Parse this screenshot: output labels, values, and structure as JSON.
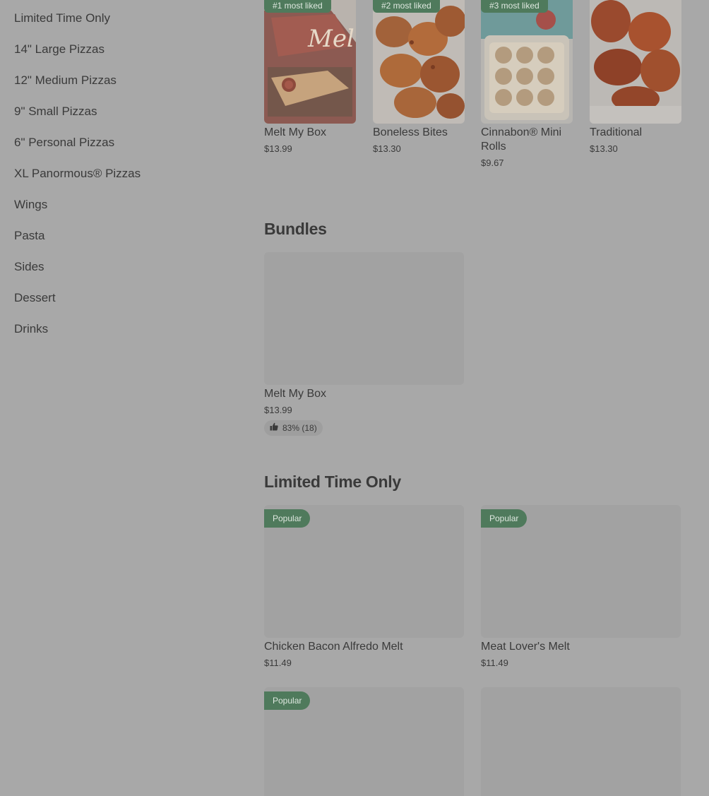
{
  "sidebar": {
    "items": [
      {
        "label": "Limited Time Only"
      },
      {
        "label": "14\" Large Pizzas"
      },
      {
        "label": "12\" Medium Pizzas"
      },
      {
        "label": "9\" Small Pizzas"
      },
      {
        "label": "6\" Personal Pizzas"
      },
      {
        "label": "XL Panormous® Pizzas"
      },
      {
        "label": "Wings"
      },
      {
        "label": "Pasta"
      },
      {
        "label": "Sides"
      },
      {
        "label": "Dessert"
      },
      {
        "label": "Drinks"
      }
    ]
  },
  "featured": {
    "items": [
      {
        "badge": "#1 most liked",
        "name": "Melt My Box",
        "price": "$13.99"
      },
      {
        "badge": "#2 most liked",
        "name": "Boneless Bites",
        "price": "$13.30"
      },
      {
        "badge": "#3 most liked",
        "name": "Cinnabon® Mini Rolls",
        "price": "$9.67"
      },
      {
        "name": "Traditional",
        "price": "$13.30"
      }
    ]
  },
  "bundles": {
    "title": "Bundles",
    "items": [
      {
        "name": "Melt My Box",
        "price": "$13.99",
        "rating": "83% (18)"
      }
    ]
  },
  "limited": {
    "title": "Limited Time Only",
    "items": [
      {
        "badge": "Popular",
        "name": "Chicken Bacon Alfredo Melt",
        "price": "$11.49"
      },
      {
        "badge": "Popular",
        "name": "Meat Lover's Melt",
        "price": "$11.49"
      },
      {
        "badge": "Popular"
      }
    ]
  },
  "colors": {
    "overlay_bg": "#a8a8a8",
    "badge_green": "#4f7a5c"
  }
}
